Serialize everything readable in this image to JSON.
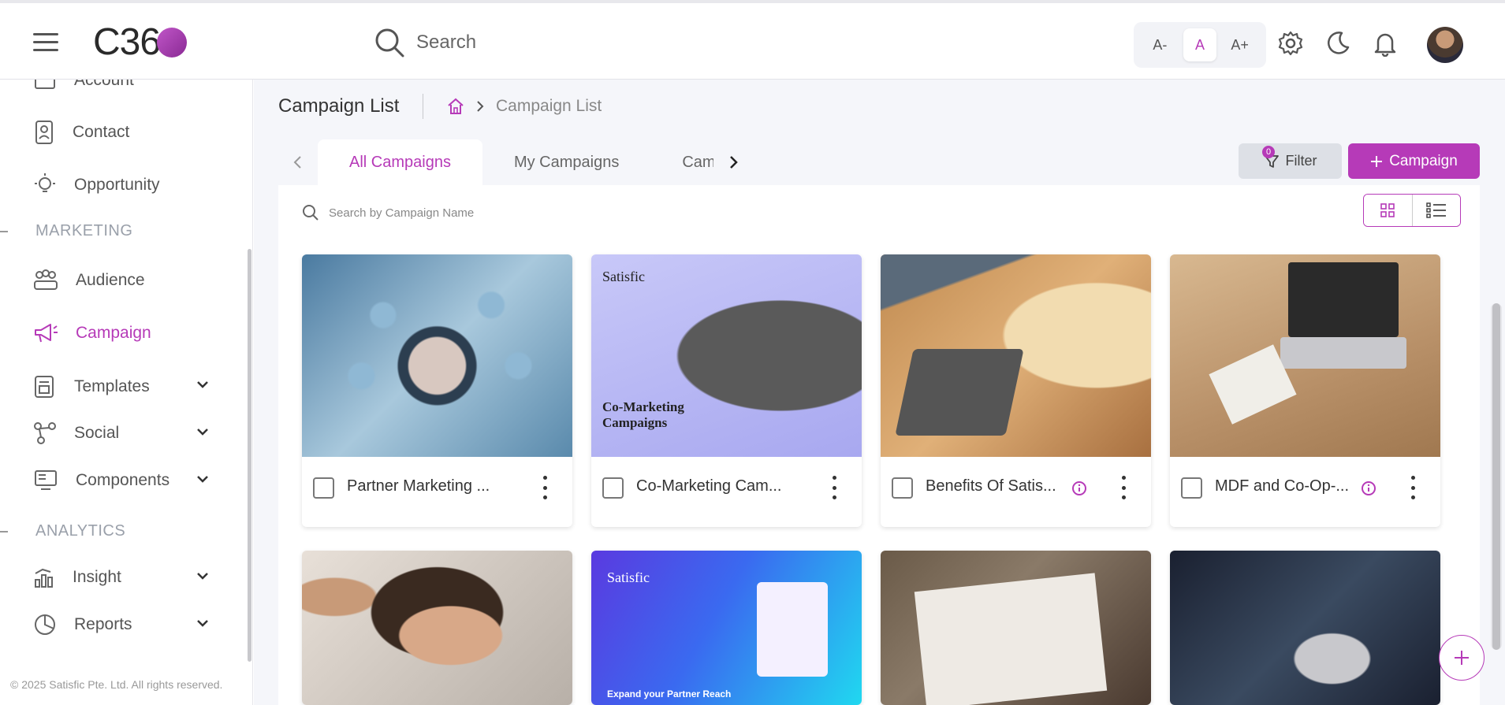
{
  "header": {
    "logo_text": "C36",
    "search_label": "Search",
    "font_small": "A-",
    "font_normal": "A",
    "font_large": "A+"
  },
  "sidebar": {
    "partial_top": "Account",
    "items": [
      {
        "label": "Contact",
        "icon": "contact-icon"
      },
      {
        "label": "Opportunity",
        "icon": "lightbulb-icon"
      }
    ],
    "marketing_section": "MARKETING",
    "marketing_items": [
      {
        "label": "Audience",
        "icon": "audience-icon"
      },
      {
        "label": "Campaign",
        "icon": "megaphone-icon"
      },
      {
        "label": "Templates",
        "icon": "template-icon"
      },
      {
        "label": "Social",
        "icon": "share-icon"
      },
      {
        "label": "Components",
        "icon": "components-icon"
      }
    ],
    "analytics_section": "ANALYTICS",
    "analytics_items": [
      {
        "label": "Insight",
        "icon": "bar-chart-icon"
      },
      {
        "label": "Reports",
        "icon": "pie-chart-icon"
      }
    ],
    "footer": "© 2025 Satisfic Pte. Ltd. All rights reserved."
  },
  "page": {
    "title": "Campaign List",
    "breadcrumb_current": "Campaign List",
    "tabs": [
      "All Campaigns",
      "My Campaigns",
      "Campaigns"
    ],
    "filter_label": "Filter",
    "filter_count": "0",
    "new_campaign_label": "Campaign",
    "search_placeholder": "Search by Campaign Name"
  },
  "cards": [
    {
      "title": "Partner Marketing ...",
      "has_info": false
    },
    {
      "title": "Co-Marketing Cam...",
      "has_info": false,
      "brand": "Satisfic",
      "heading": "Co-Marketing Campaigns"
    },
    {
      "title": "Benefits Of Satis...",
      "has_info": true
    },
    {
      "title": "MDF and Co-Op-...",
      "has_info": true
    },
    {
      "title": "",
      "has_info": false
    },
    {
      "title": "",
      "has_info": false,
      "brand": "Satisfic",
      "heading": "Expand your Partner Reach"
    },
    {
      "title": "",
      "has_info": false
    },
    {
      "title": "",
      "has_info": false
    }
  ],
  "colors": {
    "accent": "#b63ab8",
    "background": "#f5f6fa"
  }
}
